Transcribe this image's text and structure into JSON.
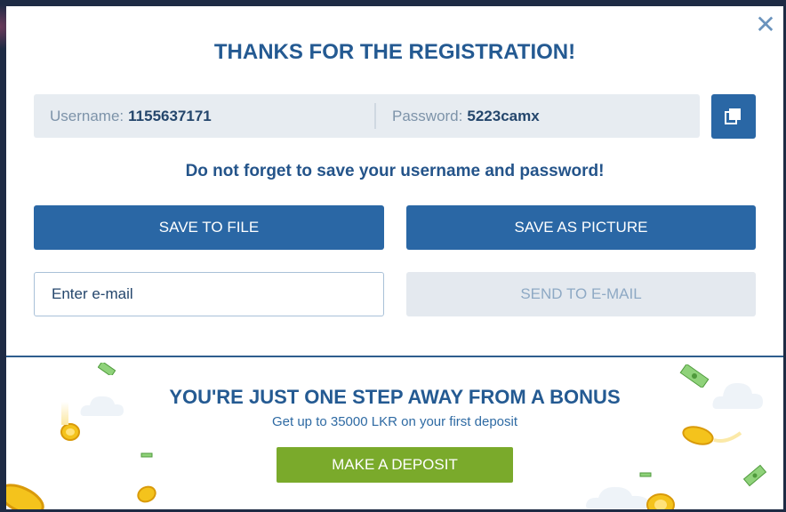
{
  "modal": {
    "close_icon": "close-icon",
    "title": "THANKS FOR THE REGISTRATION!",
    "credentials": {
      "username_label": "Username:",
      "username_value": "1155637171",
      "password_label": "Password:",
      "password_value": "5223camx",
      "copy_icon": "copy-icon"
    },
    "reminder": "Do not forget to save your username and password!",
    "save_to_file_label": "SAVE TO FILE",
    "save_as_picture_label": "SAVE AS PICTURE",
    "email_placeholder": "Enter e-mail",
    "send_email_label": "SEND TO E-MAIL"
  },
  "promo": {
    "title": "YOU'RE JUST ONE STEP AWAY FROM A BONUS",
    "subtitle": "Get up to 35000 LKR on your first deposit",
    "deposit_label": "MAKE A DEPOSIT",
    "decorations": [
      "coin-icon",
      "banknote-icon",
      "cloud-icon"
    ]
  },
  "colors": {
    "primary": "#2a67a5",
    "title": "#245a92",
    "deposit": "#7aaa2b",
    "disabled_bg": "#e4e9ef",
    "disabled_text": "#8ea9c4",
    "cred_bg": "#e7ecf1"
  }
}
